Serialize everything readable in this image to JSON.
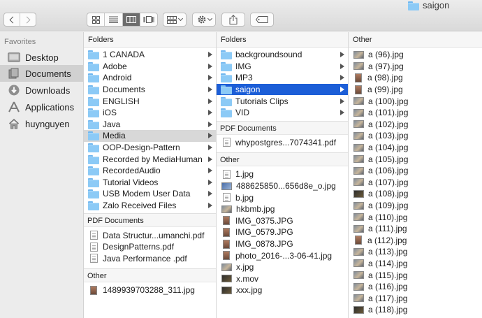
{
  "window": {
    "title": "saigon"
  },
  "toolbar": {
    "back_icon": "chevron-left-icon",
    "forward_icon": "chevron-right-icon",
    "views": [
      "icon-view",
      "list-view",
      "column-view",
      "cover-flow-view"
    ],
    "active_view": "column-view"
  },
  "sidebar": {
    "heading": "Favorites",
    "items": [
      {
        "label": "Desktop",
        "icon": "desktop-icon"
      },
      {
        "label": "Documents",
        "icon": "documents-icon",
        "selected": true
      },
      {
        "label": "Downloads",
        "icon": "downloads-icon"
      },
      {
        "label": "Applications",
        "icon": "applications-icon"
      },
      {
        "label": "huynguyen",
        "icon": "home-icon"
      }
    ]
  },
  "col1": {
    "header": "Folders",
    "folders": [
      "1 CANADA",
      "Adobe",
      "Android",
      "Documents",
      "ENGLISH",
      "iOS",
      "Java",
      "Media",
      "OOP-Design-Pattern",
      "Recorded by MediaHuman",
      "RecordedAudio",
      "Tutorial Videos",
      "USB Modem User Data",
      "Zalo Received Files"
    ],
    "pdf_header": "PDF Documents",
    "pdfs": [
      "Data Structur...umanchi.pdf",
      "DesignPatterns.pdf",
      "Java Performance .pdf"
    ],
    "other_header": "Other",
    "others": [
      "1489939703288_311.jpg"
    ]
  },
  "col2": {
    "header": "Folders",
    "folders": [
      "backgroundsound",
      "IMG",
      "MP3",
      "saigon",
      "Tutorials Clips",
      "VID"
    ],
    "pdf_header": "PDF Documents",
    "pdfs": [
      "whypostgres...7074341.pdf"
    ],
    "other_header": "Other",
    "others": [
      "1.jpg",
      "488625850...656d8e_o.jpg",
      "b.jpg",
      "hkbmb.jpg",
      "IMG_0375.JPG",
      "IMG_0579.JPG",
      "IMG_0878.JPG",
      "photo_2016-...3-06-41.jpg",
      "x.jpg",
      "x.mov",
      "xxx.jpg"
    ]
  },
  "col3": {
    "header": "Other",
    "files": [
      "a (96).jpg",
      "a (97).jpg",
      "a (98).jpg",
      "a (99).jpg",
      "a (100).jpg",
      "a (101).jpg",
      "a (102).jpg",
      "a (103).jpg",
      "a (104).jpg",
      "a (105).jpg",
      "a (106).jpg",
      "a (107).jpg",
      "a (108).jpg",
      "a (109).jpg",
      "a (110).jpg",
      "a (111).jpg",
      "a (112).jpg",
      "a (113).jpg",
      "a (114).jpg",
      "a (115).jpg",
      "a (116).jpg",
      "a (117).jpg",
      "a (118).jpg"
    ]
  },
  "colors": {
    "selection": "#1c5ed7",
    "folder": "#8ccaf6"
  }
}
